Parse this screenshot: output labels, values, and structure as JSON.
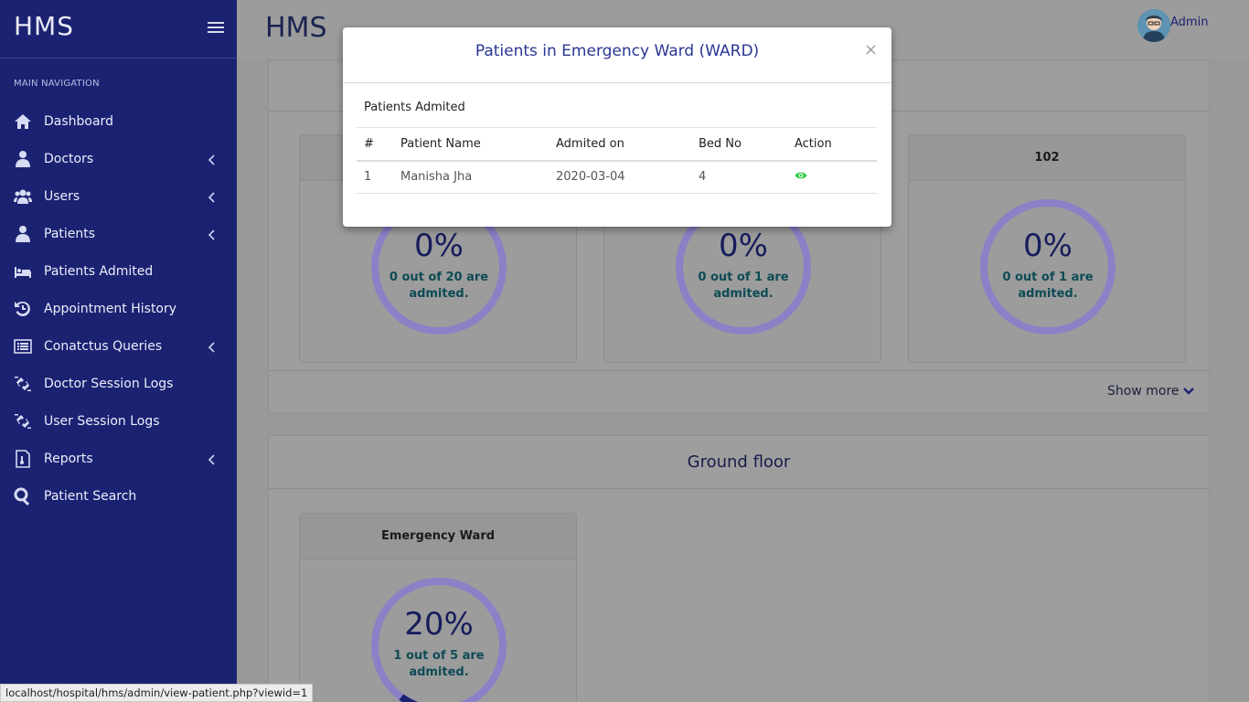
{
  "sidebar": {
    "brand": "HMS",
    "heading": "MAIN NAVIGATION",
    "items": [
      {
        "label": "Dashboard",
        "icon": "home-icon"
      },
      {
        "label": "Doctors",
        "icon": "doctor-icon"
      },
      {
        "label": "Users",
        "icon": "users-icon"
      },
      {
        "label": "Patients",
        "icon": "user-icon"
      },
      {
        "label": "Patients Admited",
        "icon": "bed-icon"
      },
      {
        "label": "Appointment History",
        "icon": "history-icon"
      },
      {
        "label": "Conatctus Queries",
        "icon": "list-icon"
      },
      {
        "label": "Doctor Session Logs",
        "icon": "unlink-icon"
      },
      {
        "label": "User Session Logs",
        "icon": "unlink-icon"
      },
      {
        "label": "Reports",
        "icon": "report-icon"
      },
      {
        "label": "Patient Search",
        "icon": "search-icon"
      }
    ]
  },
  "topbar": {
    "title": "HMS",
    "user": "Admin"
  },
  "top_panel": {
    "cards": [
      {
        "title": "",
        "percent": "0%",
        "text": "0 out of 20 are admited.",
        "fill": 0
      },
      {
        "title": "",
        "percent": "0%",
        "text": "0 out of 1 are admited.",
        "fill": 0
      },
      {
        "title": "102",
        "percent": "0%",
        "text": "0 out of 1 are admited.",
        "fill": 0
      }
    ],
    "show_more": "Show more"
  },
  "ground_panel": {
    "title": "Ground floor",
    "cards": [
      {
        "title": "Emergency Ward",
        "percent": "20%",
        "text": "1 out of 5 are admited.",
        "fill": 0.2
      }
    ]
  },
  "modal": {
    "title": "Patients in Emergency Ward (WARD)",
    "close": "×",
    "subheading": "Patients Admited",
    "columns": [
      "#",
      "Patient Name",
      "Admited on",
      "Bed No",
      "Action"
    ],
    "rows": [
      {
        "num": "1",
        "name": "Manisha Jha",
        "date": "2020-03-04",
        "bed": "4"
      }
    ]
  },
  "status_url": "localhost/hospital/hms/admin/view-patient.php?viewid=1",
  "colors": {
    "sidebar": "#1b2272",
    "ring_track": "#8c80c6",
    "ring_fill": "#1b2272",
    "accent_text": "#2a3693",
    "action_icon": "#2ecc40"
  }
}
